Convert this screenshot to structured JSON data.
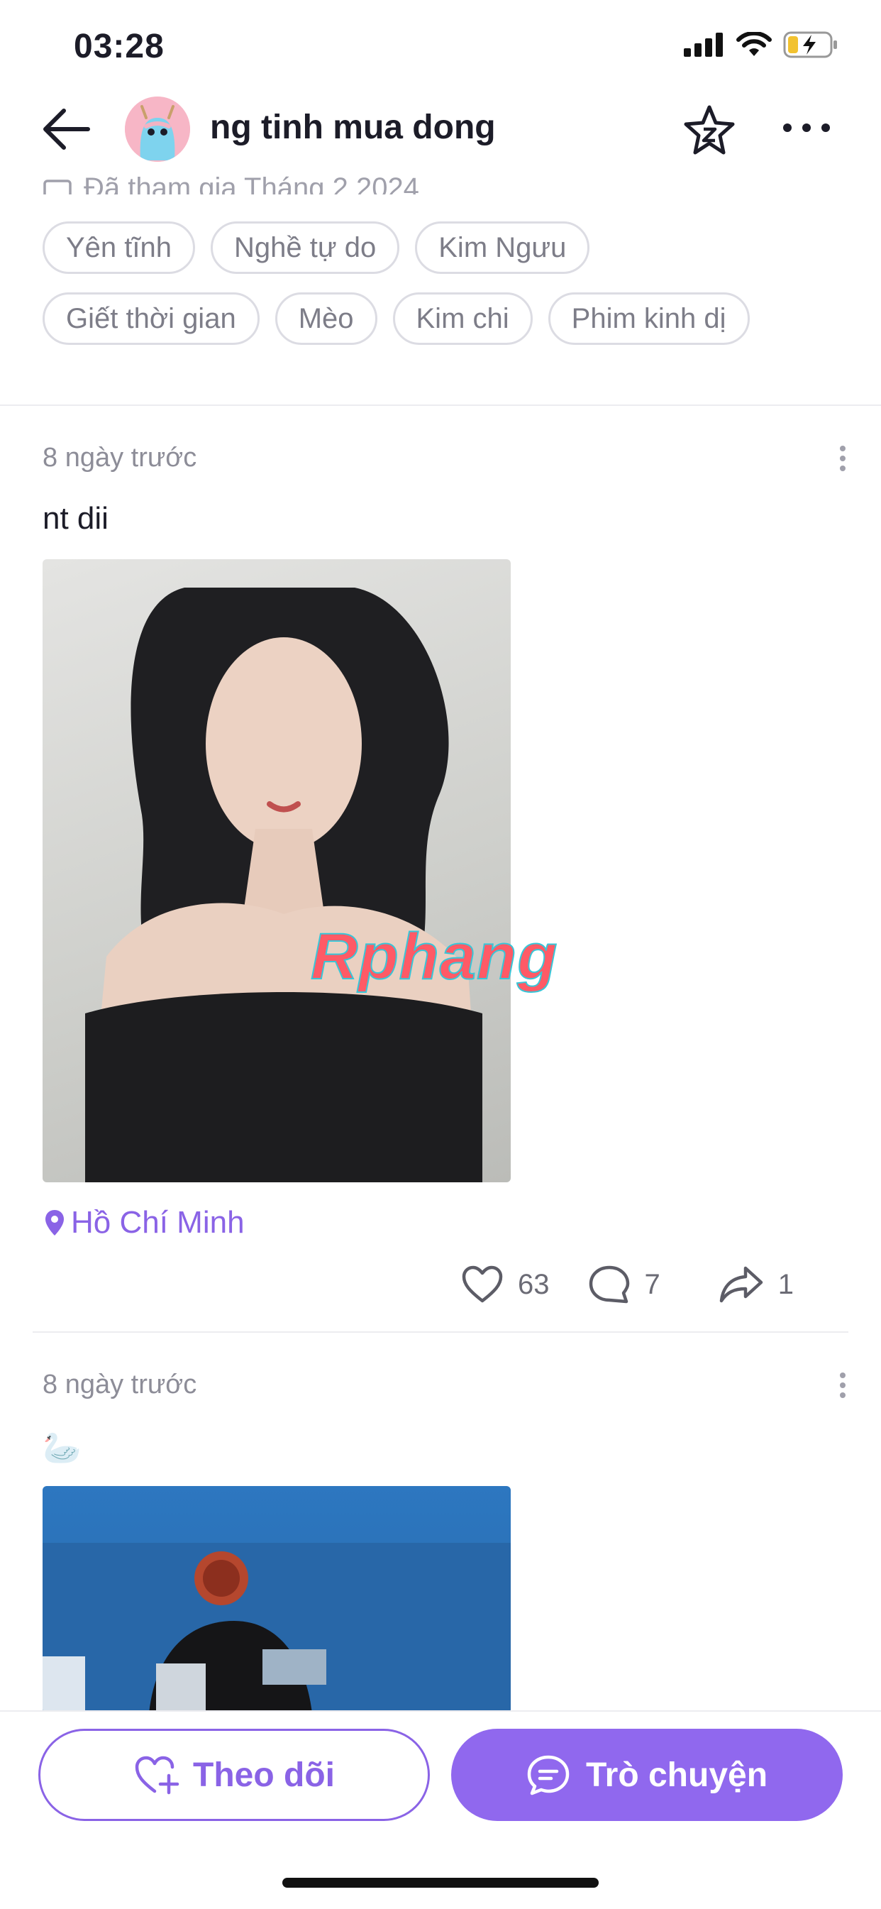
{
  "status_bar": {
    "time": "03:28"
  },
  "header": {
    "title": "ng tinh mua dong"
  },
  "profile": {
    "joined_text": "Đã tham gia Tháng 2 2024",
    "tags_row1": [
      "Yên tĩnh",
      "Nghề tự do",
      "Kim Ngưu"
    ],
    "tags_row2": [
      "Giết thời gian",
      "Mèo",
      "Kim chi",
      "Phim kinh dị"
    ]
  },
  "posts": [
    {
      "time": "8 ngày trước",
      "text": "nt dii",
      "watermark": "Rphang",
      "location": "Hồ Chí Minh",
      "likes": "63",
      "comments": "7",
      "shares": "1"
    },
    {
      "time": "8 ngày trước",
      "text": "🦢"
    }
  ],
  "bottom_bar": {
    "follow_label": "Theo dõi",
    "chat_label": "Trò chuyện"
  },
  "colors": {
    "accent": "#8a63e6",
    "chat_button": "#9068ee",
    "tag_border": "#dcdce3",
    "muted_text": "#8d8d98"
  }
}
